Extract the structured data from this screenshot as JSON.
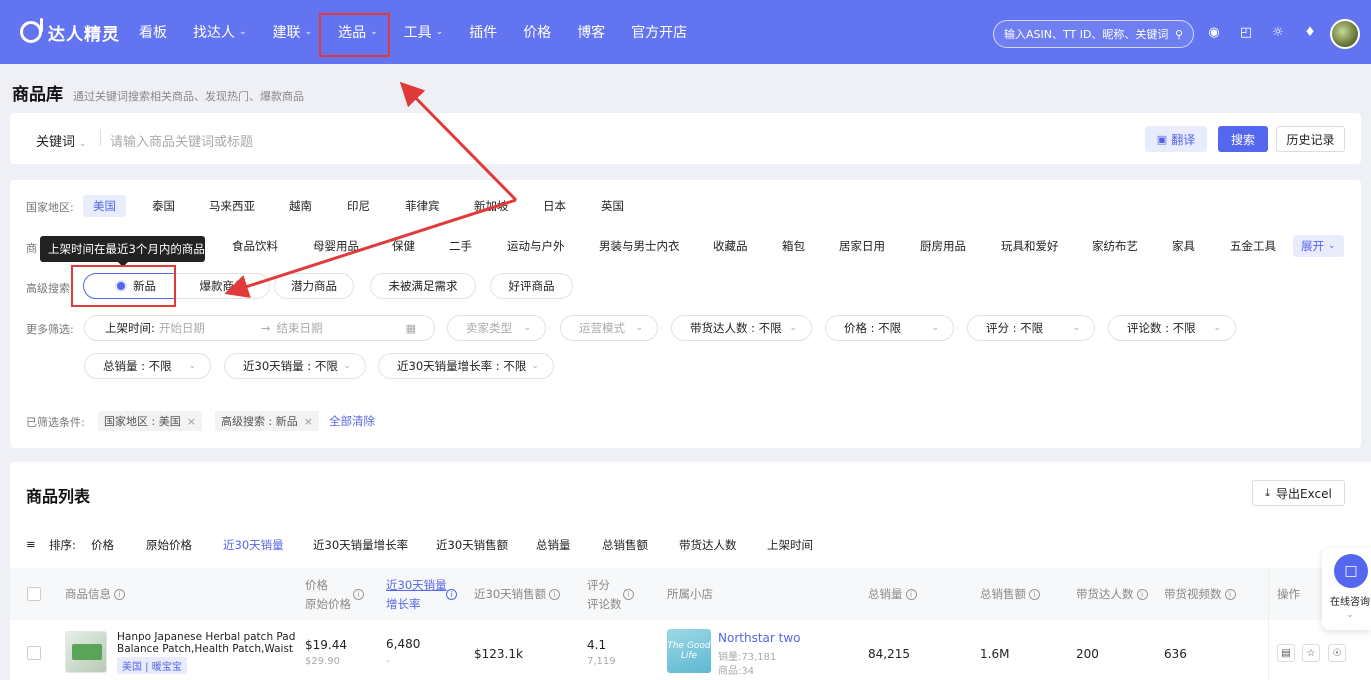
{
  "brand": {
    "name": "达人精灵"
  },
  "nav": [
    {
      "label": "看板",
      "dropdown": false
    },
    {
      "label": "找达人",
      "dropdown": true
    },
    {
      "label": "建联",
      "dropdown": true
    },
    {
      "label": "选品",
      "dropdown": true
    },
    {
      "label": "工具",
      "dropdown": true
    },
    {
      "label": "插件",
      "dropdown": false
    },
    {
      "label": "价格",
      "dropdown": false
    },
    {
      "label": "博客",
      "dropdown": false
    },
    {
      "label": "官方开店",
      "dropdown": false
    }
  ],
  "top_search": {
    "placeholder": "输入ASIN、TT ID、昵称、关键词"
  },
  "page": {
    "title": "商品库",
    "subtitle": "通过关键词搜索相关商品、发现热门、爆款商品"
  },
  "keyword": {
    "select": "关键词",
    "placeholder": "请输入商品关键词或标题",
    "translate": "翻译",
    "search": "搜索",
    "history": "历史记录"
  },
  "region": {
    "label": "国家地区:",
    "options": [
      "美国",
      "泰国",
      "马来西亚",
      "越南",
      "印尼",
      "菲律宾",
      "新加坡",
      "日本",
      "英国"
    ],
    "selected": "美国"
  },
  "category": {
    "label_prefix": "商",
    "options": [
      "食品饮料",
      "母婴用品",
      "保健",
      "二手",
      "运动与户外",
      "男装与男士内衣",
      "收藏品",
      "箱包",
      "居家日用",
      "厨房用品",
      "玩具和爱好",
      "家纺布艺",
      "家具",
      "五金工具"
    ],
    "expand": "展开"
  },
  "tooltip": "上架时间在最近3个月内的商品",
  "advanced": {
    "label": "高级搜索",
    "options": [
      "新品",
      "爆款商品",
      "潜力商品",
      "未被满足需求",
      "好评商品"
    ],
    "selected": "新品"
  },
  "more_filters": {
    "label": "更多筛选:",
    "date_label": "上架时间:",
    "date_start": "开始日期",
    "date_end": "结束日期",
    "row1": [
      "卖家类型",
      "运营模式",
      "带货达人数 : 不限",
      "价格 : 不限",
      "评分 : 不限",
      "评论数 : 不限"
    ],
    "row2": [
      "总销量 : 不限",
      "近30天销量 : 不限",
      "近30天销量增长率 : 不限"
    ]
  },
  "selected_filters": {
    "label": "已筛选条件:",
    "tags": [
      "国家地区 : 美国",
      "高级搜索 : 新品"
    ],
    "clear": "全部清除"
  },
  "list": {
    "title": "商品列表",
    "export": "导出Excel"
  },
  "sort": {
    "label": "排序:",
    "options": [
      "价格",
      "原始价格",
      "近30天销量",
      "近30天销量增长率",
      "近30天销售额",
      "总销量",
      "总销售额",
      "带货达人数",
      "上架时间"
    ],
    "active": "近30天销量"
  },
  "table": {
    "headers": {
      "product": "商品信息",
      "price": "价格",
      "orig_price": "原始价格",
      "sales30": "近30天销量",
      "growth": "增长率",
      "revenue30": "近30天销售额",
      "rating": "评分",
      "reviews": "评论数",
      "shop": "所属小店",
      "total_sales": "总销量",
      "total_revenue": "总销售额",
      "creators": "带货达人数",
      "videos": "带货视频数",
      "ops": "操作"
    },
    "rows": [
      {
        "name": "Hanpo Japanese Herbal patch Pad Balance Patch,Health Patch,Waist an…",
        "tag": "美国 | 暖宝宝",
        "price": "$19.44",
        "orig_price": "$29.90",
        "sales30": "6,480",
        "growth": "-",
        "revenue30": "$123.1k",
        "rating": "4.1",
        "reviews": "7,119",
        "shop_img_text": "The Good Life",
        "shop_name": "Northstar two",
        "shop_sales": "销量:73,181",
        "shop_products": "商品:34",
        "total_sales": "84,215",
        "total_revenue": "1.6M",
        "creators": "200",
        "videos": "636"
      }
    ]
  },
  "chat": {
    "label": "在线咨询"
  },
  "colors": {
    "nav_bg": "#6374f0",
    "accent": "#5566e6",
    "highlight": "#e03a3a"
  }
}
